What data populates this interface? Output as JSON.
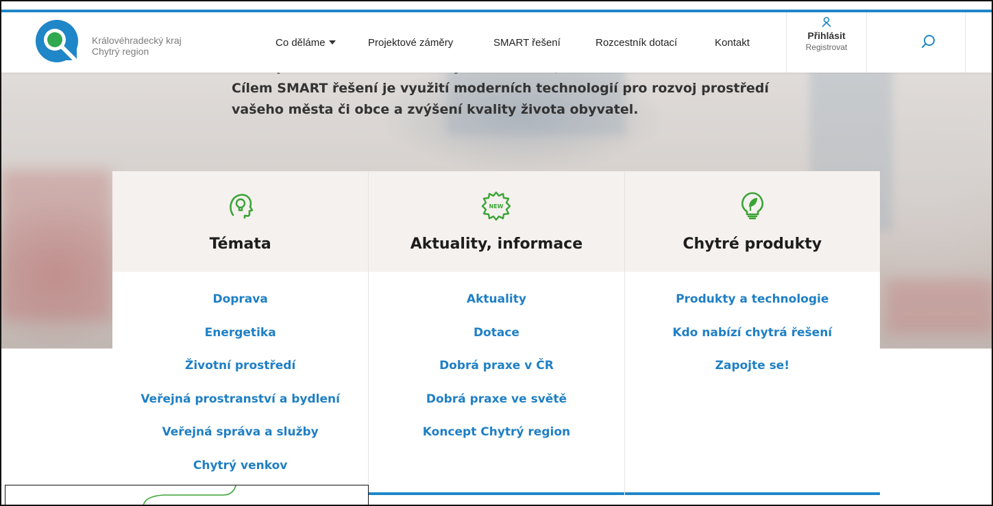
{
  "brand": {
    "name_line1": "Královéhradecký kraj",
    "name_line2": "Chytrý region",
    "logo_icon": "magnifier-logo-icon"
  },
  "nav": {
    "items": [
      {
        "label": "Co děláme",
        "has_dropdown": true
      },
      {
        "label": "Projektové záměry"
      },
      {
        "label": "SMART řešení"
      },
      {
        "label": "Rozcestník dotací"
      },
      {
        "label": "Kontakt"
      }
    ],
    "login_label": "Přihlásit",
    "register_label": "Registrovat",
    "user_icon": "user-icon",
    "search_icon": "search-icon"
  },
  "intro": {
    "cut_line": "Koncept SMART řešení obsahuje řadu témat, s nimiž se setkáte zde.",
    "text": "Cílem SMART řešení je využití moderních technologií pro rozvoj prostředí vašeho města či obce a zvýšení kvality života obyvatel."
  },
  "cards": [
    {
      "title": "Témata",
      "icon": "head-bulb-icon",
      "links": [
        "Doprava",
        "Energetika",
        "Životní prostředí",
        "Veřejná prostranství a bydlení",
        "Veřejná správa a služby",
        "Chytrý venkov"
      ]
    },
    {
      "title": "Aktuality, informace",
      "icon": "new-badge-icon",
      "icon_text": "NEW",
      "links": [
        "Aktuality",
        "Dotace",
        "Dobrá praxe v ČR",
        "Dobrá praxe ve světě",
        "Koncept Chytrý region"
      ]
    },
    {
      "title": "Chytré produkty",
      "icon": "lightbulb-leaf-icon",
      "links": [
        "Produkty a technologie",
        "Kdo nabízí chytrá řešení",
        "Zapojte se!"
      ]
    }
  ],
  "colors": {
    "accent": "#1f86c8",
    "link": "#1f7fc4",
    "icon_green": "#3aa335",
    "card_head_bg": "#f5f1ee",
    "logo_green": "#2fa84f"
  }
}
